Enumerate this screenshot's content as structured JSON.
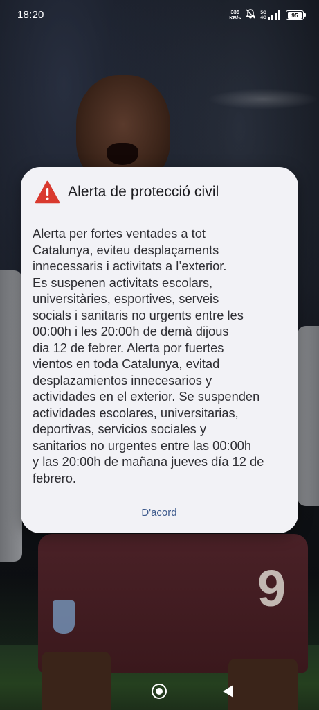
{
  "status_bar": {
    "time": "18:20",
    "net_speed_value": "335",
    "net_speed_unit": "KB/s",
    "signal_top": "5G",
    "signal_bottom": "4G",
    "battery": "95"
  },
  "dialog": {
    "title": "Alerta de protecció civil",
    "body": "Alerta per fortes ventades a tot\nCatalunya, eviteu desplaçaments\ninnecessaris i activitats a l’exterior.\nEs suspenen activitats escolars,\nuniversitàries, esportives, serveis\nsocials i sanitaris no urgents entre les\n00:00h i les 20:00h de demà dijous\ndia 12 de febrer. Alerta por fuertes\nvientos en toda Catalunya, evitad\ndesplazamientos innecesarios y\nactividades en el exterior. Se suspenden\nactividades escolares, universitarias,\ndeportivas, servicios sociales y\nsanitarios no urgentes entre las 00:00h\ny las 20:00h de mañana jueves día 12 de\nfebrero.",
    "ok_label": "D'acord",
    "accent_color": "#3d5a8c",
    "warning_color": "#d93a2f"
  },
  "background": {
    "jersey_number": "9"
  },
  "icons": {
    "warning": "warning-triangle-icon",
    "mute": "bell-off-icon",
    "home": "home-circle-icon",
    "back": "back-triangle-icon"
  }
}
